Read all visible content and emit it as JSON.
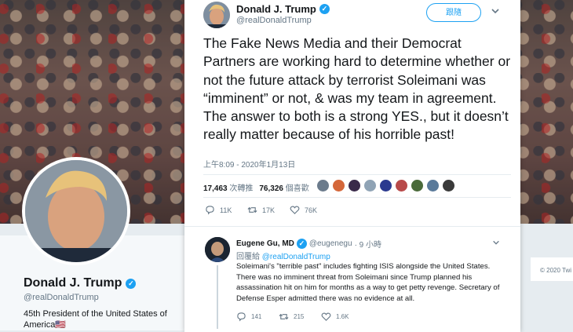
{
  "background_profile": {
    "name": "Donald J. Trump",
    "handle": "@realDonaldTrump",
    "bio": "45th President of the United States of America",
    "flag": "🇺🇸",
    "copyright": "© 2020 Twi"
  },
  "tweet": {
    "author_name": "Donald J. Trump",
    "author_handle": "@realDonaldTrump",
    "follow_label": "跟隨",
    "text": "The Fake News Media and their Democrat Partners are working hard to determine whether or not the future attack by terrorist Soleimani was “imminent” or not, & was my team in agreement. The answer to both is a strong YES., but it doesn’t really matter because of his horrible past!",
    "timestamp": "上午8:09 - 2020年1月13日",
    "retweets_count": "17,463",
    "retweets_label": "次轉推",
    "likes_count": "76,326",
    "likes_label": "個喜歡",
    "reply_action_count": "11K",
    "retweet_action_count": "17K",
    "like_action_count": "76K",
    "liker_colors": [
      "#6b7b8c",
      "#d4673a",
      "#3a2a4a",
      "#8fa3b5",
      "#2b3a8f",
      "#b84a4a",
      "#4a6a3a",
      "#5a7a9a",
      "#3a3a3a"
    ]
  },
  "reply": {
    "author_name": "Eugene Gu, MD",
    "author_handle": "@eugenegu",
    "time": "· 9 小時",
    "replying_prefix": "回覆給",
    "replying_handle": "@realDonaldTrump",
    "text": "Soleimani's \"terrible past\" includes fighting ISIS alongside the United States. There was no imminent threat from Soleimani since Trump planned his assassination hit on him for months as a way to get petty revenge. Secretary of Defense Esper admitted there was no evidence at all.",
    "reply_count": "141",
    "retweet_count": "215",
    "like_count": "1.6K"
  },
  "colors": {
    "accent": "#1da1f2",
    "text": "#14171a",
    "muted": "#657786"
  }
}
